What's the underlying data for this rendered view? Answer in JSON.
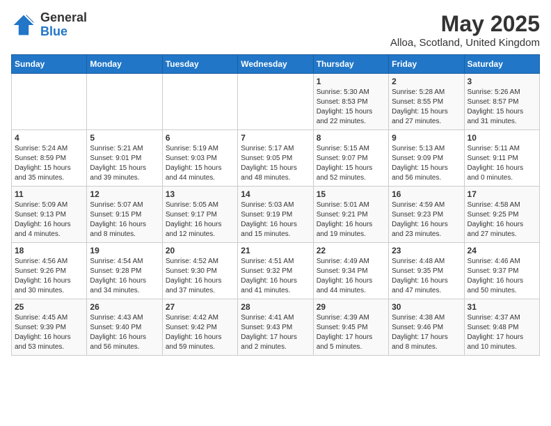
{
  "header": {
    "logo_line1": "General",
    "logo_line2": "Blue",
    "title": "May 2025",
    "subtitle": "Alloa, Scotland, United Kingdom"
  },
  "weekdays": [
    "Sunday",
    "Monday",
    "Tuesday",
    "Wednesday",
    "Thursday",
    "Friday",
    "Saturday"
  ],
  "weeks": [
    [
      {
        "day": "",
        "sunrise": "",
        "sunset": "",
        "daylight": ""
      },
      {
        "day": "",
        "sunrise": "",
        "sunset": "",
        "daylight": ""
      },
      {
        "day": "",
        "sunrise": "",
        "sunset": "",
        "daylight": ""
      },
      {
        "day": "",
        "sunrise": "",
        "sunset": "",
        "daylight": ""
      },
      {
        "day": "1",
        "sunrise": "Sunrise: 5:30 AM",
        "sunset": "Sunset: 8:53 PM",
        "daylight": "Daylight: 15 hours and 22 minutes."
      },
      {
        "day": "2",
        "sunrise": "Sunrise: 5:28 AM",
        "sunset": "Sunset: 8:55 PM",
        "daylight": "Daylight: 15 hours and 27 minutes."
      },
      {
        "day": "3",
        "sunrise": "Sunrise: 5:26 AM",
        "sunset": "Sunset: 8:57 PM",
        "daylight": "Daylight: 15 hours and 31 minutes."
      }
    ],
    [
      {
        "day": "4",
        "sunrise": "Sunrise: 5:24 AM",
        "sunset": "Sunset: 8:59 PM",
        "daylight": "Daylight: 15 hours and 35 minutes."
      },
      {
        "day": "5",
        "sunrise": "Sunrise: 5:21 AM",
        "sunset": "Sunset: 9:01 PM",
        "daylight": "Daylight: 15 hours and 39 minutes."
      },
      {
        "day": "6",
        "sunrise": "Sunrise: 5:19 AM",
        "sunset": "Sunset: 9:03 PM",
        "daylight": "Daylight: 15 hours and 44 minutes."
      },
      {
        "day": "7",
        "sunrise": "Sunrise: 5:17 AM",
        "sunset": "Sunset: 9:05 PM",
        "daylight": "Daylight: 15 hours and 48 minutes."
      },
      {
        "day": "8",
        "sunrise": "Sunrise: 5:15 AM",
        "sunset": "Sunset: 9:07 PM",
        "daylight": "Daylight: 15 hours and 52 minutes."
      },
      {
        "day": "9",
        "sunrise": "Sunrise: 5:13 AM",
        "sunset": "Sunset: 9:09 PM",
        "daylight": "Daylight: 15 hours and 56 minutes."
      },
      {
        "day": "10",
        "sunrise": "Sunrise: 5:11 AM",
        "sunset": "Sunset: 9:11 PM",
        "daylight": "Daylight: 16 hours and 0 minutes."
      }
    ],
    [
      {
        "day": "11",
        "sunrise": "Sunrise: 5:09 AM",
        "sunset": "Sunset: 9:13 PM",
        "daylight": "Daylight: 16 hours and 4 minutes."
      },
      {
        "day": "12",
        "sunrise": "Sunrise: 5:07 AM",
        "sunset": "Sunset: 9:15 PM",
        "daylight": "Daylight: 16 hours and 8 minutes."
      },
      {
        "day": "13",
        "sunrise": "Sunrise: 5:05 AM",
        "sunset": "Sunset: 9:17 PM",
        "daylight": "Daylight: 16 hours and 12 minutes."
      },
      {
        "day": "14",
        "sunrise": "Sunrise: 5:03 AM",
        "sunset": "Sunset: 9:19 PM",
        "daylight": "Daylight: 16 hours and 15 minutes."
      },
      {
        "day": "15",
        "sunrise": "Sunrise: 5:01 AM",
        "sunset": "Sunset: 9:21 PM",
        "daylight": "Daylight: 16 hours and 19 minutes."
      },
      {
        "day": "16",
        "sunrise": "Sunrise: 4:59 AM",
        "sunset": "Sunset: 9:23 PM",
        "daylight": "Daylight: 16 hours and 23 minutes."
      },
      {
        "day": "17",
        "sunrise": "Sunrise: 4:58 AM",
        "sunset": "Sunset: 9:25 PM",
        "daylight": "Daylight: 16 hours and 27 minutes."
      }
    ],
    [
      {
        "day": "18",
        "sunrise": "Sunrise: 4:56 AM",
        "sunset": "Sunset: 9:26 PM",
        "daylight": "Daylight: 16 hours and 30 minutes."
      },
      {
        "day": "19",
        "sunrise": "Sunrise: 4:54 AM",
        "sunset": "Sunset: 9:28 PM",
        "daylight": "Daylight: 16 hours and 34 minutes."
      },
      {
        "day": "20",
        "sunrise": "Sunrise: 4:52 AM",
        "sunset": "Sunset: 9:30 PM",
        "daylight": "Daylight: 16 hours and 37 minutes."
      },
      {
        "day": "21",
        "sunrise": "Sunrise: 4:51 AM",
        "sunset": "Sunset: 9:32 PM",
        "daylight": "Daylight: 16 hours and 41 minutes."
      },
      {
        "day": "22",
        "sunrise": "Sunrise: 4:49 AM",
        "sunset": "Sunset: 9:34 PM",
        "daylight": "Daylight: 16 hours and 44 minutes."
      },
      {
        "day": "23",
        "sunrise": "Sunrise: 4:48 AM",
        "sunset": "Sunset: 9:35 PM",
        "daylight": "Daylight: 16 hours and 47 minutes."
      },
      {
        "day": "24",
        "sunrise": "Sunrise: 4:46 AM",
        "sunset": "Sunset: 9:37 PM",
        "daylight": "Daylight: 16 hours and 50 minutes."
      }
    ],
    [
      {
        "day": "25",
        "sunrise": "Sunrise: 4:45 AM",
        "sunset": "Sunset: 9:39 PM",
        "daylight": "Daylight: 16 hours and 53 minutes."
      },
      {
        "day": "26",
        "sunrise": "Sunrise: 4:43 AM",
        "sunset": "Sunset: 9:40 PM",
        "daylight": "Daylight: 16 hours and 56 minutes."
      },
      {
        "day": "27",
        "sunrise": "Sunrise: 4:42 AM",
        "sunset": "Sunset: 9:42 PM",
        "daylight": "Daylight: 16 hours and 59 minutes."
      },
      {
        "day": "28",
        "sunrise": "Sunrise: 4:41 AM",
        "sunset": "Sunset: 9:43 PM",
        "daylight": "Daylight: 17 hours and 2 minutes."
      },
      {
        "day": "29",
        "sunrise": "Sunrise: 4:39 AM",
        "sunset": "Sunset: 9:45 PM",
        "daylight": "Daylight: 17 hours and 5 minutes."
      },
      {
        "day": "30",
        "sunrise": "Sunrise: 4:38 AM",
        "sunset": "Sunset: 9:46 PM",
        "daylight": "Daylight: 17 hours and 8 minutes."
      },
      {
        "day": "31",
        "sunrise": "Sunrise: 4:37 AM",
        "sunset": "Sunset: 9:48 PM",
        "daylight": "Daylight: 17 hours and 10 minutes."
      }
    ]
  ]
}
